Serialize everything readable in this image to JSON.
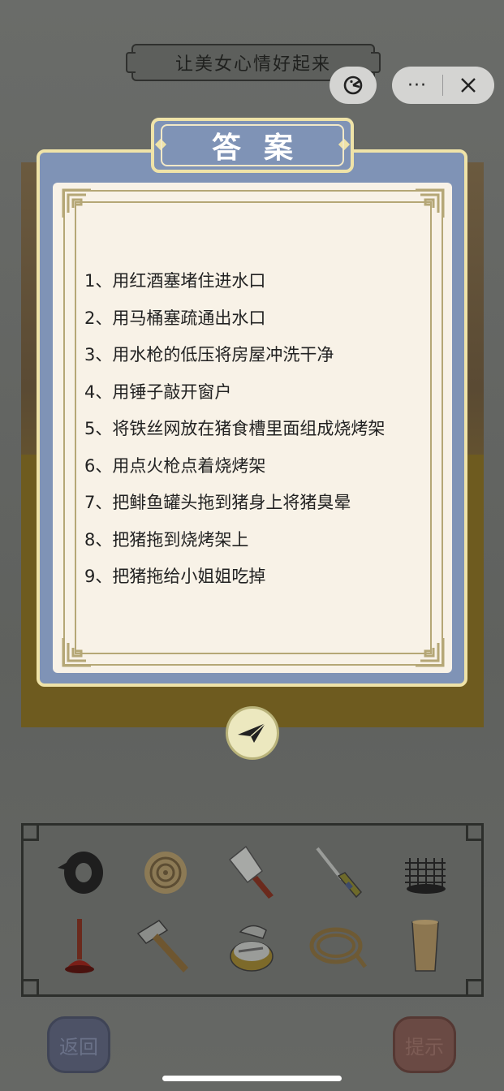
{
  "header": {
    "title": "让美女心情好起来",
    "more_label": "···"
  },
  "dialog": {
    "title": "答案",
    "steps": [
      "1、用红酒塞堵住进水口",
      "2、用马桶塞疏通出水口",
      "3、用水枪的低压将房屋冲洗干净",
      "4、用锤子敲开窗户",
      "5、将铁丝网放在猪食槽里面组成烧烤架",
      "6、用点火枪点着烧烤架",
      "7、把鲱鱼罐头拖到猪身上将猪臭晕",
      "8、把猪拖到烧烤架上",
      "9、把猪拖给小姐姐吃掉"
    ]
  },
  "inventory": {
    "items": [
      "tape-roll-icon",
      "rope-coil-icon",
      "cleaver-icon",
      "lighter-icon",
      "wire-mesh-icon",
      "plunger-icon",
      "hammer-icon",
      "fish-can-icon",
      "water-hose-icon",
      "cork-cup-icon"
    ]
  },
  "buttons": {
    "back_label": "返回",
    "hint_label": "提示"
  },
  "colors": {
    "dialog_frame": "#7f93b6",
    "dialog_border": "#efe3a8",
    "dialog_paper": "#f8f2e7",
    "ornament": "#b5a776"
  }
}
